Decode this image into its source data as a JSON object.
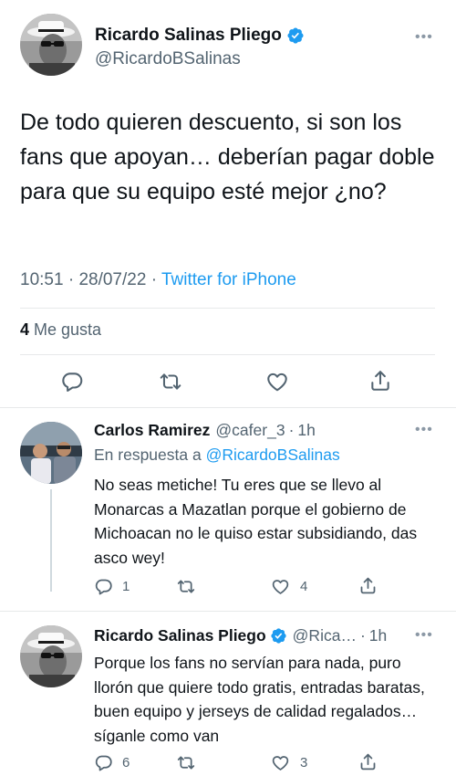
{
  "main_tweet": {
    "author_name": "Ricardo Salinas Pliego",
    "author_handle": "@RicardoBSalinas",
    "more": "•••",
    "text": "De todo quieren descuento, si son los fans que apoyan… deberían pagar doble para que su equipo esté mejor ¿no?",
    "time": "10:51",
    "date": "28/07/22",
    "separator": "·",
    "source": "Twitter for iPhone",
    "likes_count": "4",
    "likes_label": "Me gusta",
    "actions": [
      "reply-icon",
      "retweet-icon",
      "like-icon",
      "share-icon"
    ]
  },
  "replies": [
    {
      "author_name": "Carlos Ramirez",
      "author_handle": "@cafer_3",
      "separator": "·",
      "age": "1h",
      "more": "•••",
      "replying_prefix": "En respuesta a",
      "replying_to": "@RicardoBSalinas",
      "text": "No seas metiche! Tu eres que se llevo al Monarcas a Mazatlan porque el gobierno de Michoacan no le quiso estar subsidiando, das asco wey!",
      "reply_count": "1",
      "retweet_count": "",
      "like_count": "4"
    },
    {
      "author_name": "Ricardo Salinas Pliego",
      "author_handle": "@Rica…",
      "separator": "·",
      "age": "1h",
      "more": "•••",
      "text": "Porque los fans no servían para nada, puro llorón que quiere todo gratis, entradas baratas, buen equipo y jerseys de calidad regalados… síganle como van",
      "reply_count": "6",
      "retweet_count": "",
      "like_count": "3"
    }
  ],
  "colors": {
    "text": "#0f1419",
    "secondary": "#536471",
    "link": "#1d9bf0",
    "verified": "#1d9bf0",
    "divider": "#e7e9ea"
  }
}
